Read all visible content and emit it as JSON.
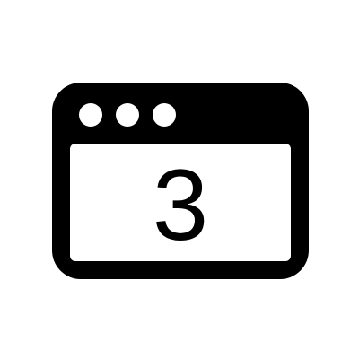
{
  "icon": {
    "name": "browser-window-3-icon",
    "number": "3",
    "dots": 3,
    "colors": {
      "foreground": "#000000",
      "background": "#ffffff"
    }
  }
}
